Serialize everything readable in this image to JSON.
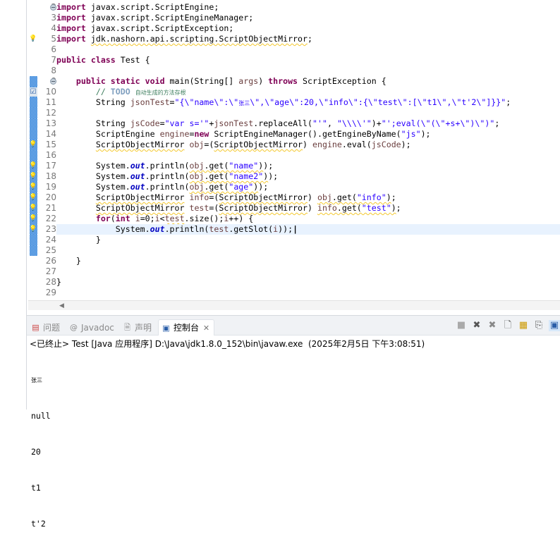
{
  "editor": {
    "current_line": 23,
    "lines": [
      {
        "n": 2,
        "fold": true,
        "t": [
          [
            "import",
            "kw"
          ],
          [
            " javax.script.ScriptEngine;",
            ""
          ]
        ]
      },
      {
        "n": 3,
        "t": [
          [
            "import",
            "kw"
          ],
          [
            " javax.script.ScriptEngineManager;",
            ""
          ]
        ]
      },
      {
        "n": 4,
        "t": [
          [
            "import",
            "kw"
          ],
          [
            " javax.script.ScriptException;",
            ""
          ]
        ]
      },
      {
        "n": 5,
        "marker": "warning-bulb",
        "t": [
          [
            "import",
            "kw"
          ],
          [
            " ",
            ""
          ],
          [
            "jdk.nashorn.api.scripting.ScriptObjectMirror",
            "warn"
          ],
          [
            ";",
            ""
          ]
        ]
      },
      {
        "n": 6,
        "t": []
      },
      {
        "n": 7,
        "t": [
          [
            "public class",
            "kw"
          ],
          [
            " Test {",
            ""
          ]
        ]
      },
      {
        "n": 8,
        "t": []
      },
      {
        "n": 9,
        "fold": true,
        "changed": true,
        "t": [
          [
            "    ",
            ""
          ],
          [
            "public static void",
            "kw"
          ],
          [
            " main(String[] ",
            ""
          ],
          [
            "args",
            "var"
          ],
          [
            ") ",
            ""
          ],
          [
            "throws",
            "kw"
          ],
          [
            " ScriptException {",
            ""
          ]
        ]
      },
      {
        "n": 10,
        "marker": "task",
        "changed": true,
        "t": [
          [
            "        // ",
            "cmt"
          ],
          [
            "TODO",
            "todo"
          ],
          [
            " ",
            "cmt"
          ],
          [
            "自动生成的方法存根",
            "cmt cjk"
          ]
        ]
      },
      {
        "n": 11,
        "changed": true,
        "t": [
          [
            "        String ",
            ""
          ],
          [
            "jsonTest",
            "var"
          ],
          [
            "=",
            ""
          ],
          [
            "\"{\\\"name\\\":\\\"",
            "str"
          ],
          [
            "张三",
            "str cjk"
          ],
          [
            "\\\",\\\"age\\\":20,\\\"info\\\":{\\\"test\\\":[\\\"t1\\\",\\\"t'2\\\"]}}\"",
            "str"
          ],
          [
            ";",
            ""
          ]
        ]
      },
      {
        "n": 12,
        "changed": true,
        "t": []
      },
      {
        "n": 13,
        "changed": true,
        "t": [
          [
            "        String ",
            ""
          ],
          [
            "jsCode",
            "var"
          ],
          [
            "=",
            ""
          ],
          [
            "\"var s='\"",
            "str"
          ],
          [
            "+",
            ""
          ],
          [
            "jsonTest",
            "var"
          ],
          [
            ".replaceAll(",
            ""
          ],
          [
            "\"'\"",
            "str"
          ],
          [
            ", ",
            ""
          ],
          [
            "\"\\\\\\\\'\"",
            "str"
          ],
          [
            ")+",
            ""
          ],
          [
            "\"';eval(\\\"(\\\"+s+\\\")\\\")\"",
            "str"
          ],
          [
            ";",
            ""
          ]
        ]
      },
      {
        "n": 14,
        "changed": true,
        "t": [
          [
            "        ScriptEngine ",
            ""
          ],
          [
            "engine",
            "var"
          ],
          [
            "=",
            ""
          ],
          [
            "new",
            "kw"
          ],
          [
            " ScriptEngineManager().getEngineByName(",
            ""
          ],
          [
            "\"js\"",
            "str"
          ],
          [
            ");",
            ""
          ]
        ]
      },
      {
        "n": 15,
        "marker": "warning-bulb",
        "changed": true,
        "t": [
          [
            "        ",
            ""
          ],
          [
            "ScriptObjectMirror",
            "warn"
          ],
          [
            " ",
            ""
          ],
          [
            "obj",
            "var"
          ],
          [
            "=(",
            ""
          ],
          [
            "ScriptObjectMirror",
            "warn"
          ],
          [
            ") ",
            ""
          ],
          [
            "engine",
            "var"
          ],
          [
            ".eval(",
            ""
          ],
          [
            "jsCode",
            "var"
          ],
          [
            ");",
            ""
          ]
        ]
      },
      {
        "n": 16,
        "changed": true,
        "t": []
      },
      {
        "n": 17,
        "marker": "warning-bulb",
        "changed": true,
        "t": [
          [
            "        System.",
            ""
          ],
          [
            "out",
            "fld"
          ],
          [
            ".println(",
            ""
          ],
          [
            "obj",
            "var warn"
          ],
          [
            ".get(",
            "warn"
          ],
          [
            "\"name\"",
            "str warn"
          ],
          [
            ")",
            "warn"
          ],
          [
            ");",
            ""
          ]
        ]
      },
      {
        "n": 18,
        "marker": "warning-bulb",
        "changed": true,
        "t": [
          [
            "        System.",
            ""
          ],
          [
            "out",
            "fld"
          ],
          [
            ".println(",
            ""
          ],
          [
            "obj",
            "var warn"
          ],
          [
            ".get(",
            "warn"
          ],
          [
            "\"name2\"",
            "str warn"
          ],
          [
            ")",
            "warn"
          ],
          [
            ");",
            ""
          ]
        ]
      },
      {
        "n": 19,
        "marker": "warning-bulb",
        "changed": true,
        "t": [
          [
            "        System.",
            ""
          ],
          [
            "out",
            "fld"
          ],
          [
            ".println(",
            ""
          ],
          [
            "obj",
            "var warn"
          ],
          [
            ".get(",
            "warn"
          ],
          [
            "\"age\"",
            "str warn"
          ],
          [
            ")",
            "warn"
          ],
          [
            ");",
            ""
          ]
        ]
      },
      {
        "n": 20,
        "marker": "warning-bulb",
        "changed": true,
        "t": [
          [
            "        ",
            ""
          ],
          [
            "ScriptObjectMirror",
            "warn"
          ],
          [
            " ",
            ""
          ],
          [
            "info",
            "var"
          ],
          [
            "=(",
            ""
          ],
          [
            "ScriptObjectMirror",
            "warn"
          ],
          [
            ") ",
            ""
          ],
          [
            "obj",
            "var warn"
          ],
          [
            ".get(",
            "warn"
          ],
          [
            "\"info\"",
            "str warn"
          ],
          [
            ")",
            "warn"
          ],
          [
            ";",
            ""
          ]
        ]
      },
      {
        "n": 21,
        "marker": "warning-bulb",
        "changed": true,
        "t": [
          [
            "        ",
            ""
          ],
          [
            "ScriptObjectMirror",
            "warn"
          ],
          [
            " ",
            ""
          ],
          [
            "test",
            "var"
          ],
          [
            "=(",
            ""
          ],
          [
            "ScriptObjectMirror",
            "warn"
          ],
          [
            ") ",
            ""
          ],
          [
            "info",
            "var warn"
          ],
          [
            ".get(",
            "warn"
          ],
          [
            "\"test\"",
            "str warn"
          ],
          [
            ")",
            "warn"
          ],
          [
            ";",
            ""
          ]
        ]
      },
      {
        "n": 22,
        "marker": "warning-bulb",
        "changed": true,
        "t": [
          [
            "        ",
            ""
          ],
          [
            "for",
            "kw"
          ],
          [
            "(",
            ""
          ],
          [
            "int",
            "kw"
          ],
          [
            " ",
            ""
          ],
          [
            "i",
            "var"
          ],
          [
            "=0;",
            ""
          ],
          [
            "i",
            "var"
          ],
          [
            "<",
            ""
          ],
          [
            "test",
            "var warn"
          ],
          [
            ".size();",
            ""
          ],
          [
            "i",
            "var"
          ],
          [
            "++) {",
            ""
          ]
        ]
      },
      {
        "n": 23,
        "marker": "warning-bulb",
        "changed": true,
        "t": [
          [
            "            System.",
            ""
          ],
          [
            "out",
            "fld"
          ],
          [
            ".println(",
            ""
          ],
          [
            "test",
            "var"
          ],
          [
            ".getSlot(",
            ""
          ],
          [
            "i",
            "var"
          ],
          [
            "));",
            ""
          ]
        ]
      },
      {
        "n": 24,
        "changed": true,
        "t": [
          [
            "        }",
            ""
          ]
        ]
      },
      {
        "n": 25,
        "changed": true,
        "t": []
      },
      {
        "n": 26,
        "t": [
          [
            "    }",
            ""
          ]
        ]
      },
      {
        "n": 27,
        "t": []
      },
      {
        "n": 28,
        "t": [
          [
            "}",
            ""
          ]
        ]
      },
      {
        "n": 29,
        "t": []
      }
    ]
  },
  "panel": {
    "tabs": [
      {
        "label": "问题",
        "icon": "problems-icon",
        "active": false
      },
      {
        "label": "Javadoc",
        "icon": "at-icon",
        "active": false
      },
      {
        "label": "声明",
        "icon": "declaration-icon",
        "active": false
      },
      {
        "label": "控制台",
        "icon": "console-icon",
        "active": true
      }
    ],
    "status": "<已终止> Test [Java 应用程序] D:\\Java\\jdk1.8.0_152\\bin\\javaw.exe  (2025年2月5日 下午3:08:51)",
    "output": [
      "张三",
      "null",
      "20",
      "t1",
      "t'2"
    ]
  }
}
